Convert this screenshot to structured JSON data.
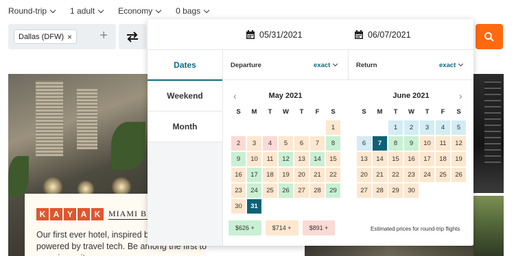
{
  "trip_options": {
    "trip_type": "Round-trip",
    "travelers": "1 adult",
    "cabin": "Economy",
    "bags": "0 bags"
  },
  "search": {
    "origin_chip": "Dallas (DFW)",
    "add_label": "+",
    "close_label": "×"
  },
  "picker": {
    "depart_date": "05/31/2021",
    "return_date": "06/07/2021",
    "modes": [
      "Dates",
      "Weekend",
      "Month"
    ],
    "departure_label": "Departure",
    "departure_mode": "exact",
    "return_label": "Return",
    "return_mode": "exact",
    "prev_arrow": "‹",
    "next_arrow": "›",
    "weekday_labels": [
      "S",
      "M",
      "T",
      "W",
      "T",
      "F",
      "S"
    ],
    "months": [
      {
        "title": "May 2021",
        "leading_blanks": 6,
        "days": [
          {
            "d": "1",
            "p": "orange"
          },
          {
            "d": "2",
            "p": "red"
          },
          {
            "d": "3",
            "p": "orange"
          },
          {
            "d": "4",
            "p": "red"
          },
          {
            "d": "5",
            "p": "orange"
          },
          {
            "d": "6",
            "p": "orange"
          },
          {
            "d": "7",
            "p": "orange"
          },
          {
            "d": "8",
            "p": "green"
          },
          {
            "d": "9",
            "p": "green"
          },
          {
            "d": "10",
            "p": "orange"
          },
          {
            "d": "11",
            "p": "orange"
          },
          {
            "d": "12",
            "p": "green"
          },
          {
            "d": "13",
            "p": "orange"
          },
          {
            "d": "14",
            "p": "green"
          },
          {
            "d": "15",
            "p": "orange"
          },
          {
            "d": "16",
            "p": "orange"
          },
          {
            "d": "17",
            "p": "green"
          },
          {
            "d": "18",
            "p": "orange"
          },
          {
            "d": "19",
            "p": "orange"
          },
          {
            "d": "20",
            "p": "orange"
          },
          {
            "d": "21",
            "p": "orange"
          },
          {
            "d": "22",
            "p": "orange"
          },
          {
            "d": "23",
            "p": "orange"
          },
          {
            "d": "24",
            "p": "green"
          },
          {
            "d": "25",
            "p": "orange"
          },
          {
            "d": "26",
            "p": "green"
          },
          {
            "d": "27",
            "p": "orange"
          },
          {
            "d": "28",
            "p": "orange"
          },
          {
            "d": "29",
            "p": "green"
          },
          {
            "d": "30",
            "p": "orange"
          },
          {
            "d": "31",
            "p": "selected"
          }
        ]
      },
      {
        "title": "June 2021",
        "leading_blanks": 2,
        "days": [
          {
            "d": "1",
            "p": "blue"
          },
          {
            "d": "2",
            "p": "blue"
          },
          {
            "d": "3",
            "p": "blue"
          },
          {
            "d": "4",
            "p": "blue"
          },
          {
            "d": "5",
            "p": "blue"
          },
          {
            "d": "6",
            "p": "blue"
          },
          {
            "d": "7",
            "p": "selected"
          },
          {
            "d": "8",
            "p": "green"
          },
          {
            "d": "9",
            "p": "green"
          },
          {
            "d": "10",
            "p": "orange"
          },
          {
            "d": "11",
            "p": "orange"
          },
          {
            "d": "12",
            "p": "orange"
          },
          {
            "d": "13",
            "p": "orange"
          },
          {
            "d": "14",
            "p": "orange"
          },
          {
            "d": "15",
            "p": "orange"
          },
          {
            "d": "16",
            "p": "orange"
          },
          {
            "d": "17",
            "p": "orange"
          },
          {
            "d": "18",
            "p": "orange"
          },
          {
            "d": "19",
            "p": "orange"
          },
          {
            "d": "20",
            "p": "orange"
          },
          {
            "d": "21",
            "p": "orange"
          },
          {
            "d": "22",
            "p": "orange"
          },
          {
            "d": "23",
            "p": "orange"
          },
          {
            "d": "24",
            "p": "orange"
          },
          {
            "d": "25",
            "p": "orange"
          },
          {
            "d": "26",
            "p": "orange"
          },
          {
            "d": "27",
            "p": "orange"
          },
          {
            "d": "28",
            "p": "orange"
          },
          {
            "d": "29",
            "p": "orange"
          },
          {
            "d": "30",
            "p": "orange"
          }
        ]
      }
    ],
    "price_legend": [
      {
        "label": "$626 +",
        "color": "green"
      },
      {
        "label": "$714 +",
        "color": "orange"
      },
      {
        "label": "$891 +",
        "color": "red"
      }
    ],
    "legend_note": "Estimated prices for round-trip flights"
  },
  "promo": {
    "logo_letters": [
      "K",
      "A",
      "Y",
      "A",
      "K"
    ],
    "location": "MIAMI BEACH",
    "text": "Our first ever hotel, inspired by locals and powered by travel tech. Be among the first to experience it."
  },
  "colors": {
    "accent": "#ff690f",
    "teal": "#0f6a7f",
    "selected_day": "#0e6175",
    "price_green": "#c9f0d3",
    "price_orange": "#fde7cf",
    "price_red": "#fbdad5",
    "range_blue": "#d4ecf4",
    "logo_red": "#e0562e"
  }
}
